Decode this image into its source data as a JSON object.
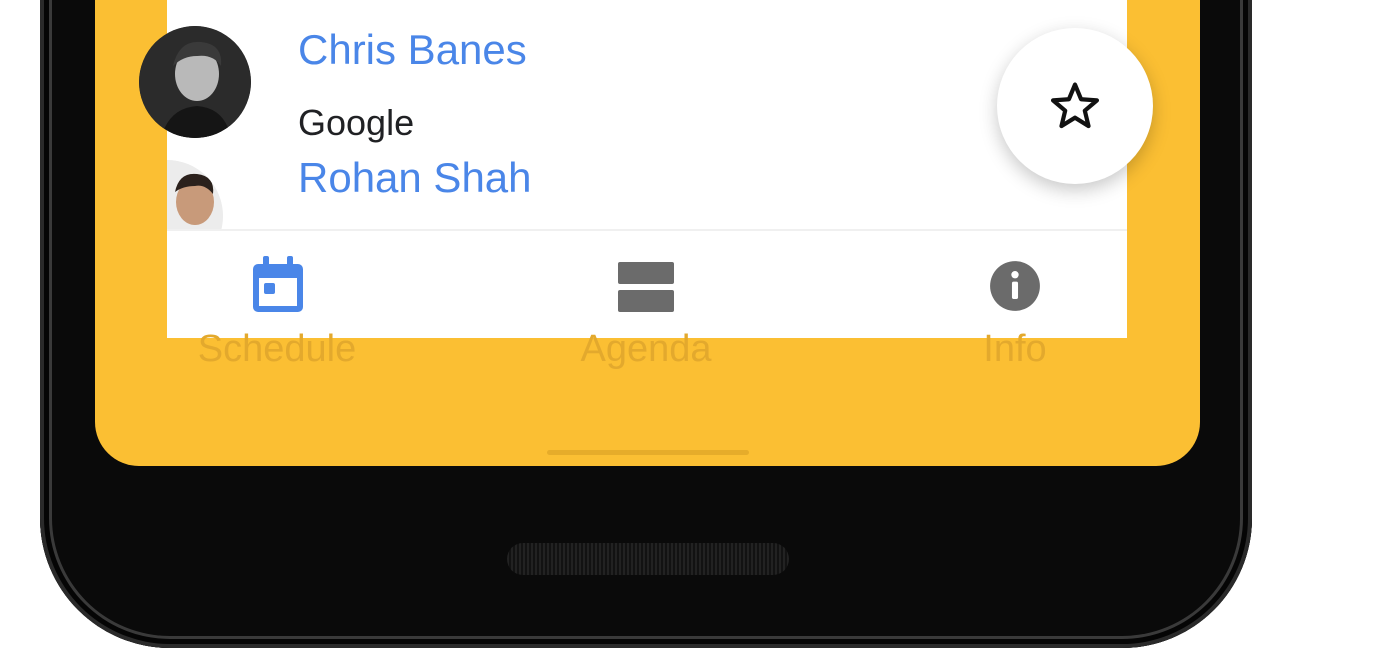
{
  "speakers": [
    {
      "name": "Chris Banes",
      "company": "Google"
    },
    {
      "name": "Rohan Shah",
      "company": ""
    }
  ],
  "fab": {
    "icon": "star-outline-icon"
  },
  "bottom_nav": [
    {
      "label": "Schedule",
      "icon": "calendar-icon",
      "selected": true
    },
    {
      "label": "Agenda",
      "icon": "agenda-icon",
      "selected": false
    },
    {
      "label": "Info",
      "icon": "info-icon",
      "selected": false
    }
  ],
  "colors": {
    "accent_blue": "#4a86e8",
    "screen_yellow": "#fbbf33",
    "nav_label": "#e3a92d"
  }
}
